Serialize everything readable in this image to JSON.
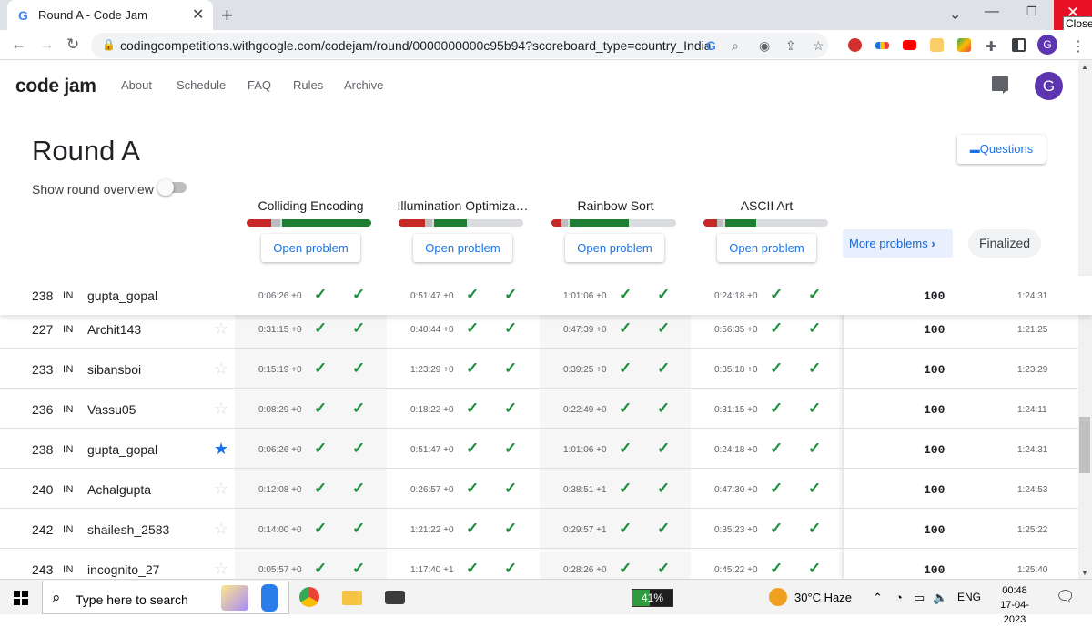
{
  "browser": {
    "tab_title": "Round A - Code Jam",
    "tab_favicon": "G",
    "tab_close": "✕",
    "new_tab": "+",
    "close_tooltip": "Close",
    "url": "codingcompetitions.withgoogle.com/codejam/round/0000000000c95b94?scoreboard_type=country_India",
    "profile_initial": "G"
  },
  "site": {
    "brand": "code jam",
    "nav": [
      "About",
      "Schedule",
      "FAQ",
      "Rules",
      "Archive"
    ],
    "avatar_initial": "G"
  },
  "round": {
    "title": "Round A",
    "overview_label": "Show round overview",
    "overview_on": false,
    "questions_label": "Questions",
    "more_problems": "More problems",
    "status": "Finalized",
    "open_label": "Open problem"
  },
  "problems": [
    {
      "title": "Colliding Encoding",
      "bar": {
        "red": 0.2,
        "gray": 0.07,
        "green": 0.73
      }
    },
    {
      "title": "Illumination Optimiza…",
      "bar": {
        "red": 0.21,
        "gray": 0.06,
        "green": 0.28
      }
    },
    {
      "title": "Rainbow Sort",
      "bar": {
        "red": 0.08,
        "gray": 0.05,
        "green": 0.49
      }
    },
    {
      "title": "ASCII Art",
      "bar": {
        "red": 0.11,
        "gray": 0.05,
        "green": 0.26
      }
    }
  ],
  "pinned_row": {
    "rank": "238",
    "country": "IN",
    "name": "gupta_gopal",
    "times": [
      "0:06:26 +0",
      "0:51:47 +0",
      "1:01:06 +0",
      "0:24:18 +0"
    ],
    "score": "100",
    "total": "1:24:31"
  },
  "rows": [
    {
      "rank": "227",
      "country": "IN",
      "name": "Archit143",
      "starred": false,
      "times": [
        "0:31:15 +0",
        "0:40:44 +0",
        "0:47:39 +0",
        "0:56:35 +0"
      ],
      "score": "100",
      "total": "1:21:25"
    },
    {
      "rank": "233",
      "country": "IN",
      "name": "sibansboi",
      "starred": false,
      "times": [
        "0:15:19 +0",
        "1:23:29 +0",
        "0:39:25 +0",
        "0:35:18 +0"
      ],
      "score": "100",
      "total": "1:23:29"
    },
    {
      "rank": "236",
      "country": "IN",
      "name": "Vassu05",
      "starred": false,
      "times": [
        "0:08:29 +0",
        "0:18:22 +0",
        "0:22:49 +0",
        "0:31:15 +0"
      ],
      "score": "100",
      "total": "1:24:11"
    },
    {
      "rank": "238",
      "country": "IN",
      "name": "gupta_gopal",
      "starred": true,
      "times": [
        "0:06:26 +0",
        "0:51:47 +0",
        "1:01:06 +0",
        "0:24:18 +0"
      ],
      "score": "100",
      "total": "1:24:31"
    },
    {
      "rank": "240",
      "country": "IN",
      "name": "Achalgupta",
      "starred": false,
      "times": [
        "0:12:08 +0",
        "0:26:57 +0",
        "0:38:51 +1",
        "0:47:30 +0"
      ],
      "score": "100",
      "total": "1:24:53"
    },
    {
      "rank": "242",
      "country": "IN",
      "name": "shailesh_2583",
      "starred": false,
      "times": [
        "0:14:00 +0",
        "1:21:22 +0",
        "0:29:57 +1",
        "0:35:23 +0"
      ],
      "score": "100",
      "total": "1:25:22"
    },
    {
      "rank": "243",
      "country": "IN",
      "name": "incognito_27",
      "starred": false,
      "times": [
        "0:05:57 +0",
        "1:17:40 +1",
        "0:28:26 +0",
        "0:45:22 +0"
      ],
      "score": "100",
      "total": "1:25:40"
    }
  ],
  "taskbar": {
    "search_placeholder": "Type here to search",
    "battery": "41%",
    "weather": "30°C  Haze",
    "lang": "ENG",
    "time": "00:48",
    "date": "17-04-2023"
  }
}
